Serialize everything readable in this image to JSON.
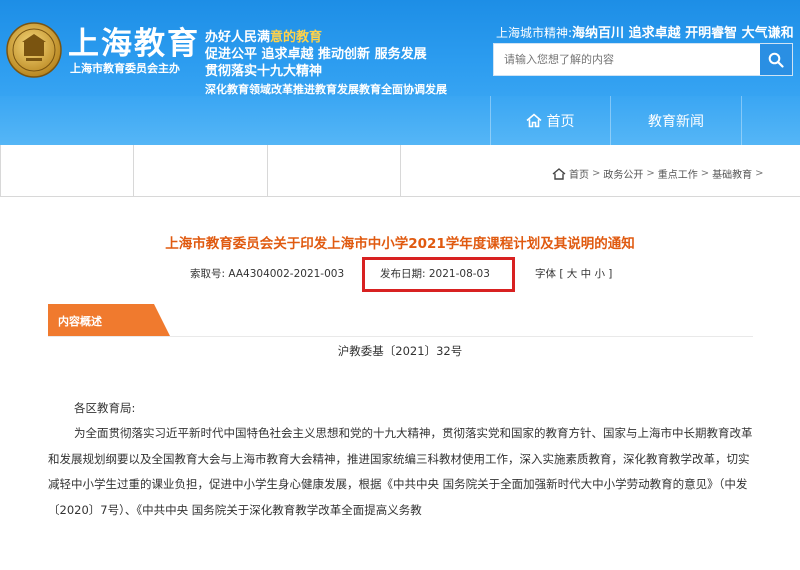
{
  "header": {
    "site_title": "上海教育",
    "site_subtitle": "上海市教育委员会主办",
    "slogan_line1_a": "办好人民满",
    "slogan_line1_b": "意的教育",
    "slogan_line2_a": "促进公平  追求卓越  推动创新  服务发展",
    "slogan_line3": "贯彻落实十九大精神",
    "slogan_line4": "深化教育领域改革推进教育发展教育全面协调发展",
    "city_spirit_label": "上海城市精神:",
    "city_spirit_text": "海纳百川 追求卓越 开明睿智 大气谦和",
    "search_placeholder": "请输入您想了解的内容"
  },
  "nav": {
    "home": "首页",
    "news": "教育新闻"
  },
  "breadcrumb": {
    "items": [
      "首页",
      "政务公开",
      "重点工作",
      "基础教育"
    ],
    "separator": ">"
  },
  "article": {
    "title": "上海市教育委员会关于印发上海市中小学2021学年度课程计划及其说明的通知",
    "index_no": "索取号: AA4304002-2021-003",
    "publish_date": "发布日期: 2021-08-03",
    "font_size": "字体 [ 大 中 小 ]",
    "section_tab": "内容概述",
    "doc_number": "沪教委基〔2021〕32号",
    "salutation": "各区教育局:",
    "body": "为全面贯彻落实习近平新时代中国特色社会主义思想和党的十九大精神，贯彻落实党和国家的教育方针、国家与上海市中长期教育改革和发展规划纲要以及全国教育大会与上海市教育大会精神，推进国家统编三科教材使用工作，深入实施素质教育，深化教育教学改革，切实减轻中小学生过重的课业负担，促进中小学生身心健康发展，根据《中共中央 国务院关于全面加强新时代大中小学劳动教育的意见》（中发〔2020〕7号）、《中共中央 国务院关于深化教育教学改革全面提高义务教"
  },
  "colors": {
    "header_blue": "#2d9df0",
    "title_orange": "#e05a10",
    "tab_orange": "#f07a2e",
    "highlight_red": "#d82121",
    "slogan_yellow": "#ffd24a"
  }
}
